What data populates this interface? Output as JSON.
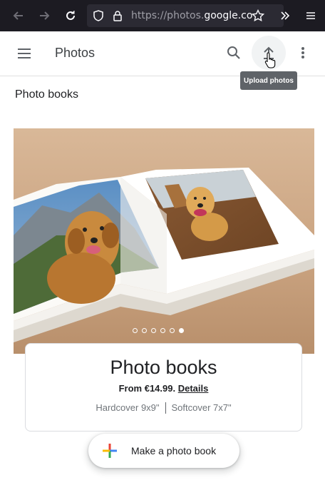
{
  "browser": {
    "url_prefix": "https://photos.",
    "url_domain": "google.com",
    "icons": [
      "back-icon",
      "forward-icon",
      "reload-icon",
      "shield-icon",
      "lock-icon",
      "star-icon",
      "overflow-chevrons-icon",
      "menu-icon"
    ]
  },
  "app": {
    "title": "Photos",
    "upload_tooltip": "Upload photos"
  },
  "section_title": "Photo books",
  "carousel": {
    "slides": 6,
    "active_slide": 6
  },
  "product": {
    "title": "Photo books",
    "price_prefix": "From €14.99.",
    "details_link": "Details",
    "variant_hardcover": "Hardcover 9x9\"",
    "variant_softcover": "Softcover 7x7\""
  },
  "cta": {
    "label": "Make a photo book"
  },
  "colors": {
    "browser_bg": "#1c1b22",
    "google_blue": "#4285f4",
    "google_red": "#ea4335",
    "google_yellow": "#fbbc04",
    "google_green": "#34a853"
  }
}
